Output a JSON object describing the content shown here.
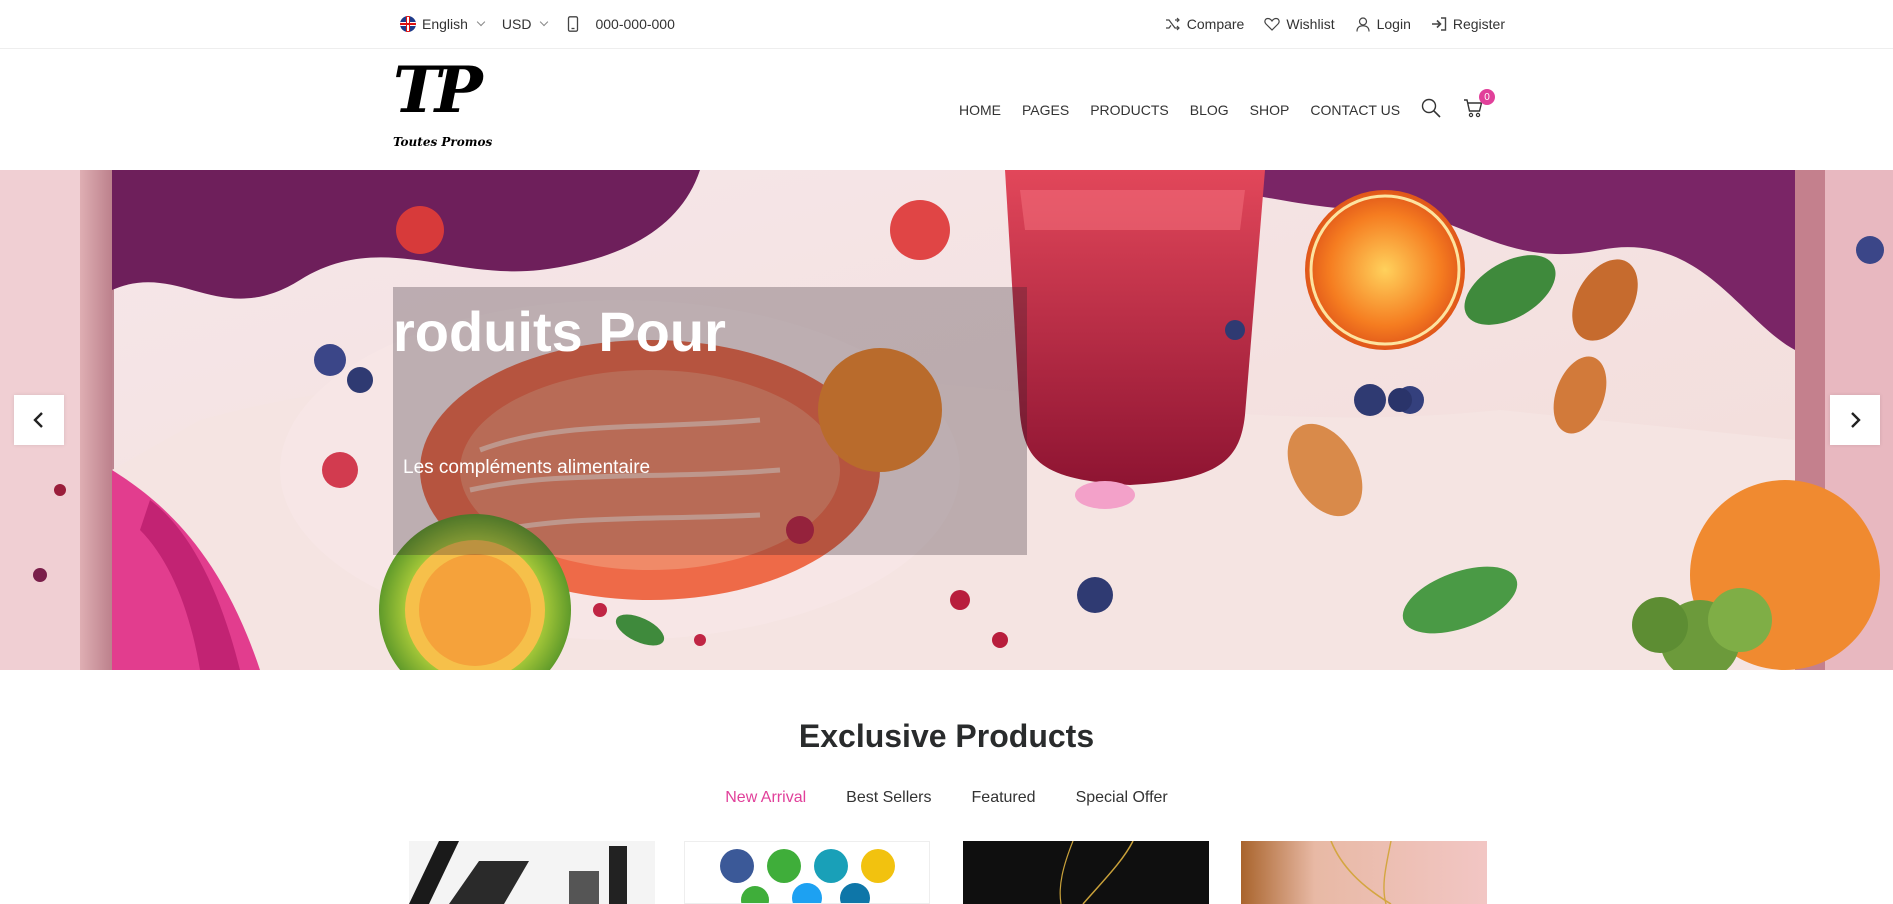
{
  "topbar": {
    "language": "English",
    "currency": "USD",
    "phone": "000-000-000",
    "compare": "Compare",
    "wishlist": "Wishlist",
    "login": "Login",
    "register": "Register"
  },
  "logo": {
    "mark": "TP",
    "tagline": "Toutes Promos"
  },
  "nav": {
    "items": [
      "HOME",
      "PAGES",
      "PRODUCTS",
      "BLOG",
      "SHOP",
      "CONTACT US"
    ],
    "cart_count": "0"
  },
  "hero": {
    "title": "roduits Pour",
    "subtitle": "Les compléments alimentaire"
  },
  "products": {
    "section_title": "Exclusive Products",
    "tabs": [
      "New Arrival",
      "Best Sellers",
      "Featured",
      "Special Offer"
    ],
    "active_tab": "New Arrival"
  },
  "colors": {
    "accent": "#e1409a",
    "text": "#292b2c"
  },
  "icons": [
    "flag-uk-icon",
    "chevron-down-icon",
    "phone-icon",
    "shuffle-icon",
    "heart-icon",
    "user-icon",
    "sign-in-icon",
    "search-icon",
    "cart-icon",
    "arrow-left-icon",
    "arrow-right-icon"
  ]
}
